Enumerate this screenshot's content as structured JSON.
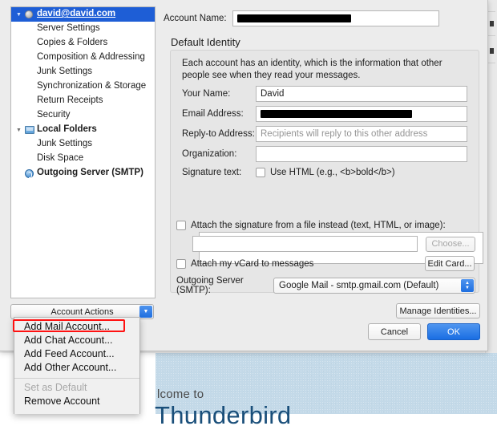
{
  "background": {
    "welcome_small": "lcome to",
    "welcome_brand": "Thunderbird"
  },
  "dialog": {
    "tree": {
      "items": [
        {
          "label": "david@david.com",
          "icon": "globe-icon",
          "twisty": "▼",
          "level": 0,
          "selected": true,
          "bold": true
        },
        {
          "label": "Server Settings",
          "icon": "none",
          "twisty": "",
          "level": 1,
          "selected": false,
          "bold": false
        },
        {
          "label": "Copies & Folders",
          "icon": "none",
          "twisty": "",
          "level": 1,
          "selected": false,
          "bold": false
        },
        {
          "label": "Composition & Addressing",
          "icon": "none",
          "twisty": "",
          "level": 1,
          "selected": false,
          "bold": false
        },
        {
          "label": "Junk Settings",
          "icon": "none",
          "twisty": "",
          "level": 1,
          "selected": false,
          "bold": false
        },
        {
          "label": "Synchronization & Storage",
          "icon": "none",
          "twisty": "",
          "level": 1,
          "selected": false,
          "bold": false
        },
        {
          "label": "Return Receipts",
          "icon": "none",
          "twisty": "",
          "level": 1,
          "selected": false,
          "bold": false
        },
        {
          "label": "Security",
          "icon": "none",
          "twisty": "",
          "level": 1,
          "selected": false,
          "bold": false
        },
        {
          "label": "Local Folders",
          "icon": "monitor-icon",
          "twisty": "▼",
          "level": 0,
          "selected": false,
          "bold": true
        },
        {
          "label": "Junk Settings",
          "icon": "none",
          "twisty": "",
          "level": 1,
          "selected": false,
          "bold": false
        },
        {
          "label": "Disk Space",
          "icon": "none",
          "twisty": "",
          "level": 1,
          "selected": false,
          "bold": false
        },
        {
          "label": "Outgoing Server (SMTP)",
          "icon": "smtp-icon",
          "twisty": "",
          "level": 0,
          "selected": false,
          "bold": true
        }
      ]
    },
    "account_actions": {
      "label": "Account Actions",
      "arrow_icon": "chevron-down-icon"
    },
    "menu": {
      "items": [
        {
          "label": "Add Mail Account...",
          "disabled": false,
          "highlighted": true
        },
        {
          "label": "Add Chat Account...",
          "disabled": false,
          "highlighted": false
        },
        {
          "label": "Add Feed Account...",
          "disabled": false,
          "highlighted": false
        },
        {
          "label": "Add Other Account...",
          "disabled": false,
          "highlighted": false
        },
        {
          "separator": true
        },
        {
          "label": "Set as Default",
          "disabled": true,
          "highlighted": false
        },
        {
          "label": "Remove Account",
          "disabled": false,
          "highlighted": false
        }
      ],
      "highlight_color": "#ff1111"
    },
    "account_name": {
      "label": "Account Name:",
      "value": "",
      "redacted": true
    },
    "default_identity": {
      "title": "Default Identity",
      "description": "Each account has an identity, which is the information that other people see when they read your messages.",
      "your_name": {
        "label": "Your Name:",
        "value": "David"
      },
      "email_address": {
        "label": "Email Address:",
        "value": "",
        "redacted": true
      },
      "reply_to": {
        "label": "Reply-to Address:",
        "value": "",
        "placeholder": "Recipients will reply to this other address"
      },
      "organization": {
        "label": "Organization:",
        "value": ""
      },
      "signature_text": {
        "label": "Signature text:",
        "value": ""
      },
      "use_html": {
        "label": "Use HTML (e.g., <b>bold</b>)",
        "checked": false
      },
      "attach_signature_file": {
        "label": "Attach the signature from a file instead (text, HTML, or image):",
        "checked": false,
        "path": ""
      },
      "choose_button": {
        "label": "Choose...",
        "disabled": true
      },
      "attach_vcard": {
        "label": "Attach my vCard to messages",
        "checked": false
      },
      "edit_card_button": {
        "label": "Edit Card...",
        "disabled": false
      },
      "outgoing_server": {
        "label": "Outgoing Server (SMTP):",
        "selected": "Google Mail - smtp.gmail.com (Default)"
      }
    },
    "buttons": {
      "manage_identities": "Manage Identities...",
      "cancel": "Cancel",
      "ok": "OK"
    }
  }
}
